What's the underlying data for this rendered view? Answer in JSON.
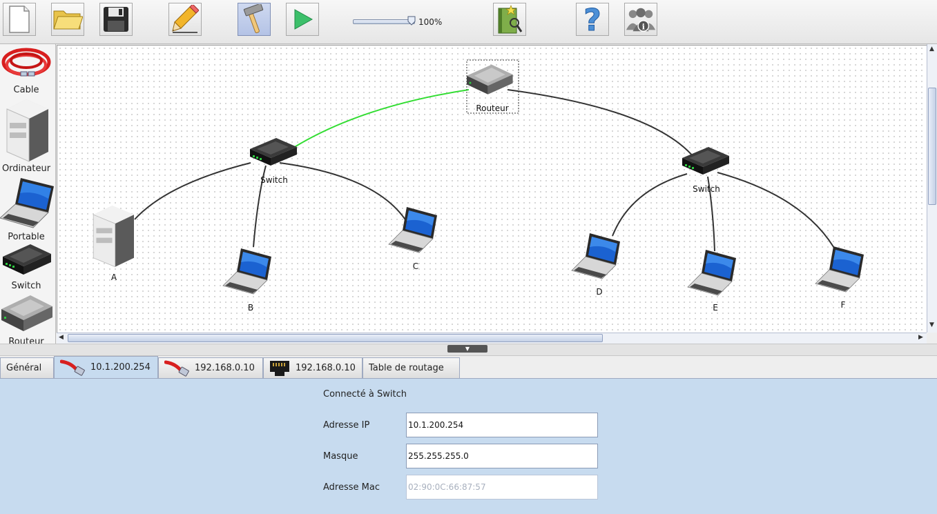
{
  "toolbar": {
    "buttons": [
      {
        "icon": "new-file-icon"
      },
      {
        "icon": "open-folder-icon"
      },
      {
        "icon": "save-disk-icon"
      },
      {
        "icon": "pencil-edit-icon"
      },
      {
        "icon": "hammer-build-icon"
      },
      {
        "icon": "play-simulate-icon"
      },
      {
        "icon": "magic-book-icon"
      },
      {
        "icon": "help-question-icon"
      },
      {
        "icon": "about-users-icon"
      }
    ],
    "zoom_value": 100,
    "zoom_label": "100%"
  },
  "palette": {
    "items": [
      {
        "label": "Cable",
        "icon": "cable-icon"
      },
      {
        "label": "Ordinateur",
        "icon": "computer-tower-icon"
      },
      {
        "label": "Portable",
        "icon": "laptop-icon"
      },
      {
        "label": "Switch",
        "icon": "switch-icon"
      },
      {
        "label": "Routeur",
        "icon": "router-icon"
      }
    ]
  },
  "network": {
    "nodes": [
      {
        "id": "routeur",
        "label": "Routeur",
        "type": "router",
        "selected": true
      },
      {
        "id": "switch1",
        "label": "Switch",
        "type": "switch"
      },
      {
        "id": "switch2",
        "label": "Switch",
        "type": "switch"
      },
      {
        "id": "A",
        "label": "A",
        "type": "computer"
      },
      {
        "id": "B",
        "label": "B",
        "type": "laptop"
      },
      {
        "id": "C",
        "label": "C",
        "type": "laptop"
      },
      {
        "id": "D",
        "label": "D",
        "type": "laptop"
      },
      {
        "id": "E",
        "label": "E",
        "type": "laptop"
      },
      {
        "id": "F",
        "label": "F",
        "type": "laptop"
      }
    ],
    "links": [
      {
        "from": "routeur",
        "to": "switch1",
        "color": "#33dd33",
        "highlighted": true
      },
      {
        "from": "routeur",
        "to": "switch2",
        "color": "#333333"
      },
      {
        "from": "switch1",
        "to": "A",
        "color": "#333333"
      },
      {
        "from": "switch1",
        "to": "B",
        "color": "#333333"
      },
      {
        "from": "switch1",
        "to": "C",
        "color": "#333333"
      },
      {
        "from": "switch2",
        "to": "D",
        "color": "#333333"
      },
      {
        "from": "switch2",
        "to": "E",
        "color": "#333333"
      },
      {
        "from": "switch2",
        "to": "F",
        "color": "#333333"
      }
    ]
  },
  "tabs": [
    {
      "label": "Général",
      "icon": "",
      "selected": false
    },
    {
      "label": "10.1.200.254",
      "icon": "red-cable-icon",
      "selected": true
    },
    {
      "label": "192.168.0.10",
      "icon": "red-cable-icon",
      "selected": false
    },
    {
      "label": "192.168.0.10",
      "icon": "ethernet-port-icon",
      "selected": false
    },
    {
      "label": "Table de routage",
      "icon": "",
      "selected": false
    }
  ],
  "panel": {
    "connected_label": "Connecté à Switch",
    "ip_label": "Adresse IP",
    "ip_value": "10.1.200.254",
    "mask_label": "Masque",
    "mask_value": "255.255.255.0",
    "mac_label": "Adresse Mac",
    "mac_value": "02:90:0C:66:87:57"
  },
  "colors": {
    "panel_bg": "#c7dbef",
    "highlight_link": "#33dd33",
    "normal_link": "#333333",
    "selection_border": "#333333"
  }
}
